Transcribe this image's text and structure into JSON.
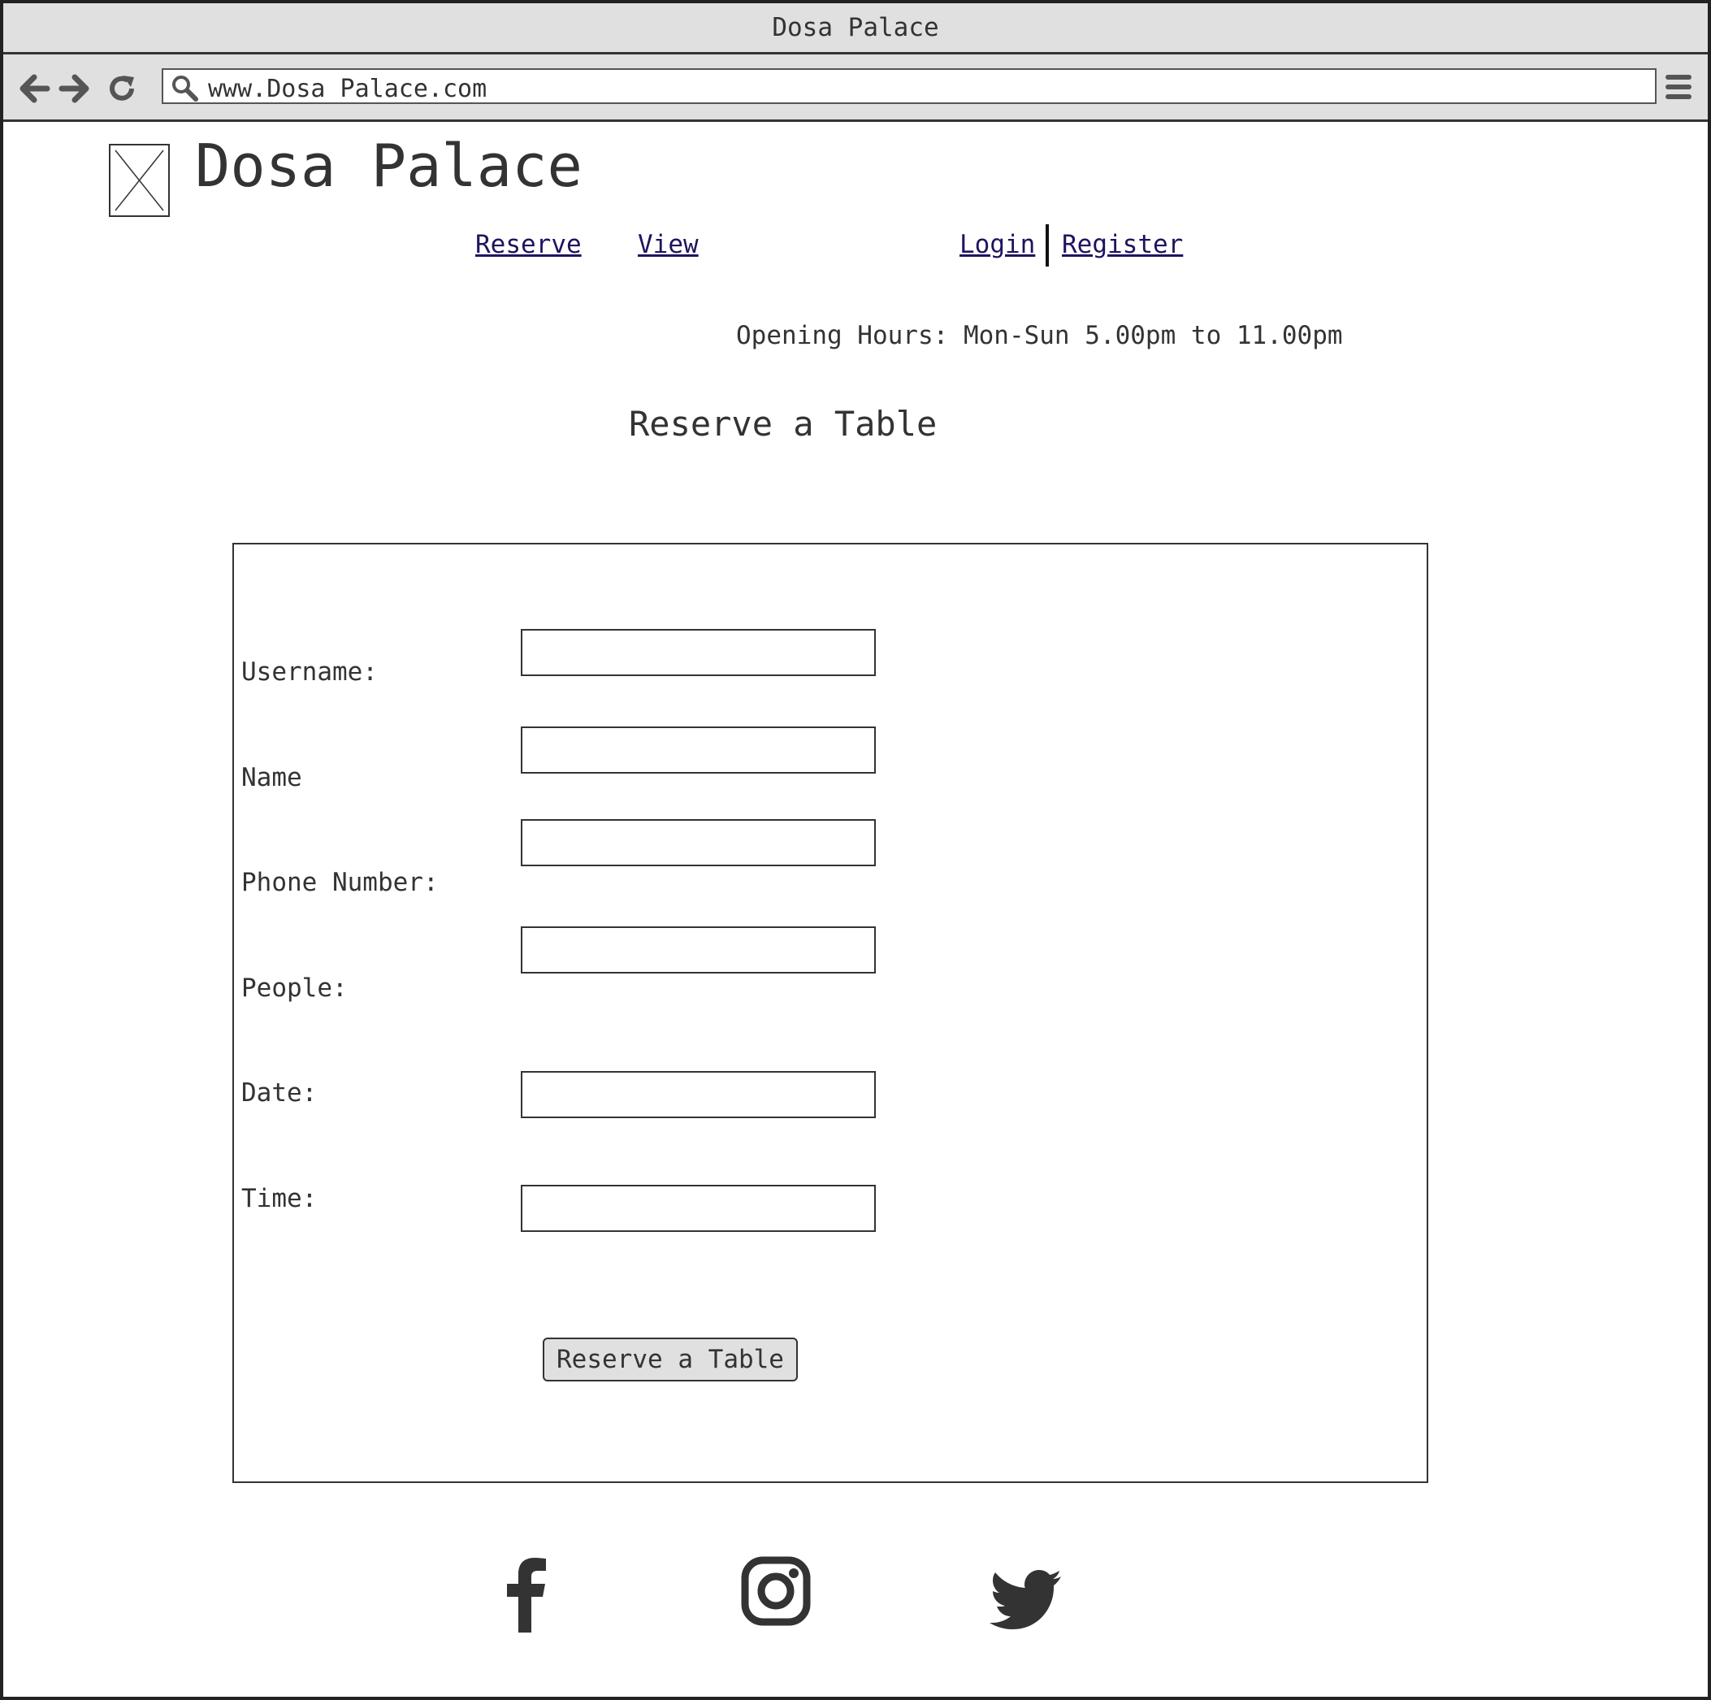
{
  "browser": {
    "window_title": "Dosa Palace",
    "url": "www.Dosa Palace.com",
    "back_icon": "arrow-left-icon",
    "forward_icon": "arrow-right-icon",
    "reload_icon": "reload-icon",
    "search_icon": "search-icon",
    "menu_icon": "hamburger-menu-icon"
  },
  "site": {
    "title": "Dosa Palace",
    "logo_icon": "image-placeholder-icon"
  },
  "nav": {
    "reserve": "Reserve",
    "view": "View",
    "login": "Login",
    "register": "Register"
  },
  "opening_hours": "Opening Hours: Mon-Sun 5.00pm to 11.00pm",
  "page_heading": "Reserve a Table",
  "form": {
    "fields": [
      {
        "label": "Username:",
        "value": ""
      },
      {
        "label": "Name",
        "value": ""
      },
      {
        "label": "Phone Number:",
        "value": ""
      },
      {
        "label": "People:",
        "value": ""
      },
      {
        "label": "Date:",
        "value": ""
      },
      {
        "label": "Time:",
        "value": ""
      }
    ],
    "submit_label": "Reserve a Table"
  },
  "social": [
    "facebook-icon",
    "instagram-icon",
    "twitter-icon"
  ],
  "colors": {
    "link": "#21135e",
    "chrome_bg": "#e0e0e0",
    "text": "#333333",
    "border": "#333333"
  }
}
